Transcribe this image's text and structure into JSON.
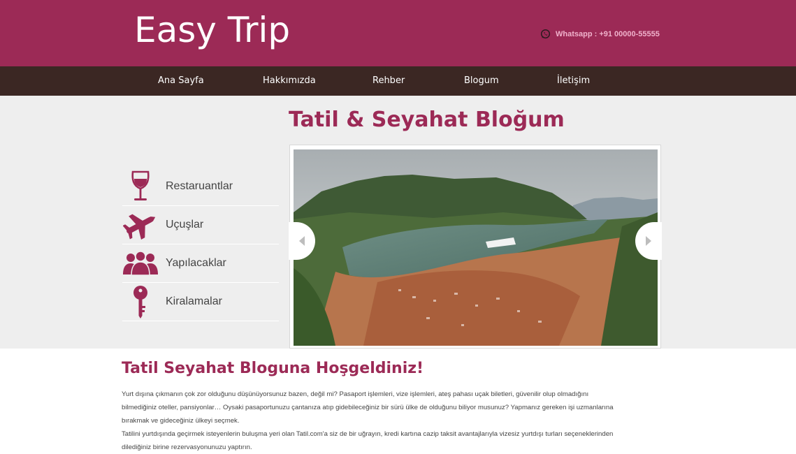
{
  "header": {
    "logo": "Easy Trip",
    "whatsapp_text": "Whatsapp : +91 00000-55555"
  },
  "nav": {
    "items": [
      "Ana Sayfa",
      "Hakkımızda",
      "Rehber",
      "Blogum",
      "İletişim"
    ]
  },
  "page_title": "Tatil & Seyahat Bloğum",
  "categories": [
    {
      "label": "Restaruantlar",
      "icon": "wine-glass-icon"
    },
    {
      "label": "Uçuşlar",
      "icon": "airplane-icon"
    },
    {
      "label": "Yapılacaklar",
      "icon": "people-icon"
    },
    {
      "label": "Kiralamalar",
      "icon": "key-icon"
    }
  ],
  "welcome": {
    "title": "Tatil Seyahat Bloguna Hoşgeldiniz!",
    "line1": "Yurt dışına çıkmanın çok zor olduğunu düşünüyorsunuz bazen, değil mi? Pasaport işlemleri, vize işlemleri, ateş pahası uçak biletleri, güvenilir olup olmadığını",
    "line2": "bilmediğiniz oteller, pansiyonlar… Oysaki pasaportunuzu çantanıza atıp gidebileceğiniz bir sürü ülke de olduğunu biliyor musunuz? Yapmanız gereken işi uzmanlarına",
    "line3": "bırakmak ve gideceğiniz ülkeyi seçmek.",
    "line4": "Tatilini yurtdışında geçirmek isteyenlerin buluşma yeri olan Tatil.com'a siz de bir uğrayın, kredi kartına cazip taksit avantajlarıyla vizesiz yurtdışı turları seçeneklerinden",
    "line5": "dilediğiniz birine rezervasyonunuzu yaptırın."
  },
  "colors": {
    "brand": "#9c2a56",
    "nav_bg": "#3b2723",
    "band_bg": "#eeeeee"
  }
}
